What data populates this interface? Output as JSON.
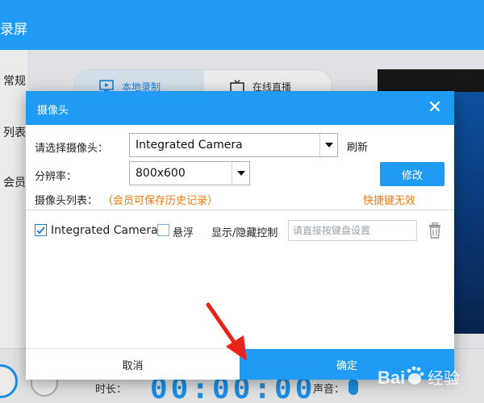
{
  "app": {
    "title": "录屏",
    "sidebar": [
      "常规",
      "列表",
      "会员"
    ],
    "mode_tabs": [
      {
        "label": "本地录制",
        "icon": "record-screen-icon",
        "active": true
      },
      {
        "label": "在线直播",
        "icon": "tv-icon",
        "active": false
      }
    ],
    "bottom": {
      "time_label": "时长：",
      "time_value": "00:00:00",
      "sound_label": "声音："
    }
  },
  "dialog": {
    "title": "摄像头",
    "close_icon": "close-icon",
    "camera_select_label": "请选择摄像头：",
    "camera_select_value": "Integrated Camera",
    "refresh_label": "刷新",
    "resolution_label": "分辨率：",
    "resolution_value": "800x600",
    "modify_label": "修改",
    "camera_list_label": "摄像头列表：",
    "camera_list_hint": "（会员可保存历史记录）",
    "hotkey_invalid": "快捷键无效",
    "camera_list": [
      {
        "name": "Integrated Camera",
        "checked": true,
        "float_label": "悬浮",
        "float_checked": false,
        "toggle_label": "显示/隐藏控制",
        "hotkey_placeholder": "请直接按键盘设置"
      }
    ],
    "cancel_label": "取消",
    "ok_label": "确定"
  },
  "colors": {
    "primary": "#1f9bf5",
    "warning": "#f07a12",
    "annotation_arrow": "#e8241a"
  },
  "watermark": "Bai 经验"
}
